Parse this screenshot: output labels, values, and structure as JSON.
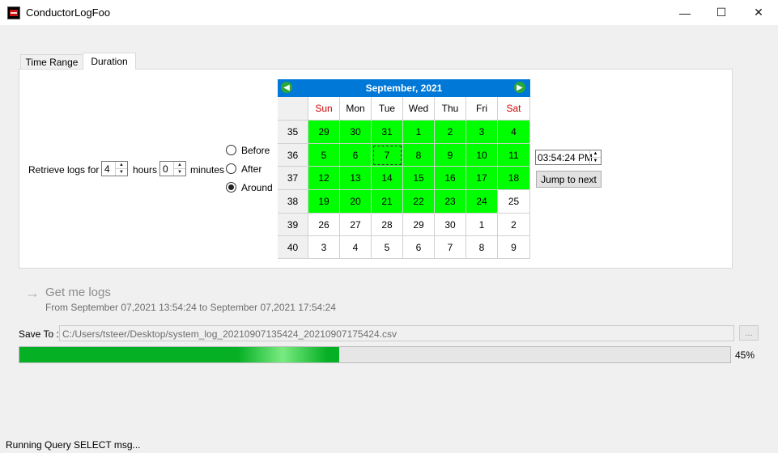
{
  "window": {
    "title": "ConductorLogFoo",
    "minimize": "—",
    "maximize": "☐",
    "close": "✕"
  },
  "tabs": [
    {
      "label": "Time Range",
      "active": false
    },
    {
      "label": "Duration",
      "active": true
    }
  ],
  "duration": {
    "retrieve_label": "Retrieve logs for",
    "hours_value": "4",
    "hours_label": "hours",
    "minutes_value": "0",
    "minutes_label": "minutes",
    "radios": [
      {
        "label": "Before",
        "checked": false
      },
      {
        "label": "After",
        "checked": false
      },
      {
        "label": "Around",
        "checked": true
      }
    ]
  },
  "calendar": {
    "title": "September,  2021",
    "prev_icon": "prev-month-icon",
    "next_icon": "next-month-icon",
    "weekdays": [
      "Sun",
      "Mon",
      "Tue",
      "Wed",
      "Thu",
      "Fri",
      "Sat"
    ],
    "weekend_color": "#cc0000",
    "highlight_color": "#00ff00",
    "weeks": [
      {
        "num": "35",
        "days": [
          "29",
          "30",
          "31",
          "1",
          "2",
          "3",
          "4"
        ],
        "hl": [
          true,
          true,
          true,
          true,
          true,
          true,
          true
        ]
      },
      {
        "num": "36",
        "days": [
          "5",
          "6",
          "7",
          "8",
          "9",
          "10",
          "11"
        ],
        "hl": [
          true,
          true,
          true,
          true,
          true,
          true,
          true
        ]
      },
      {
        "num": "37",
        "days": [
          "12",
          "13",
          "14",
          "15",
          "16",
          "17",
          "18"
        ],
        "hl": [
          true,
          true,
          true,
          true,
          true,
          true,
          true
        ]
      },
      {
        "num": "38",
        "days": [
          "19",
          "20",
          "21",
          "22",
          "23",
          "24",
          "25"
        ],
        "hl": [
          true,
          true,
          true,
          true,
          true,
          true,
          false
        ]
      },
      {
        "num": "39",
        "days": [
          "26",
          "27",
          "28",
          "29",
          "30",
          "1",
          "2"
        ],
        "hl": [
          false,
          false,
          false,
          false,
          false,
          false,
          false
        ]
      },
      {
        "num": "40",
        "days": [
          "3",
          "4",
          "5",
          "6",
          "7",
          "8",
          "9"
        ],
        "hl": [
          false,
          false,
          false,
          false,
          false,
          false,
          false
        ]
      }
    ],
    "selected_day": "7"
  },
  "time": {
    "value": "03:54:24 PM",
    "jump_label": "Jump to next"
  },
  "get_logs": {
    "title": "Get me logs",
    "range": "From September 07,2021 13:54:24 to September 07,2021 17:54:24"
  },
  "save": {
    "label": "Save To :",
    "path": "C:/Users/tsteer/Desktop/system_log_20210907135424_20210907175424.csv",
    "browse_label": "..."
  },
  "progress": {
    "fraction": 0.45,
    "text": "45%",
    "color": "#06b025"
  },
  "status": "Running Query SELECT msg..."
}
